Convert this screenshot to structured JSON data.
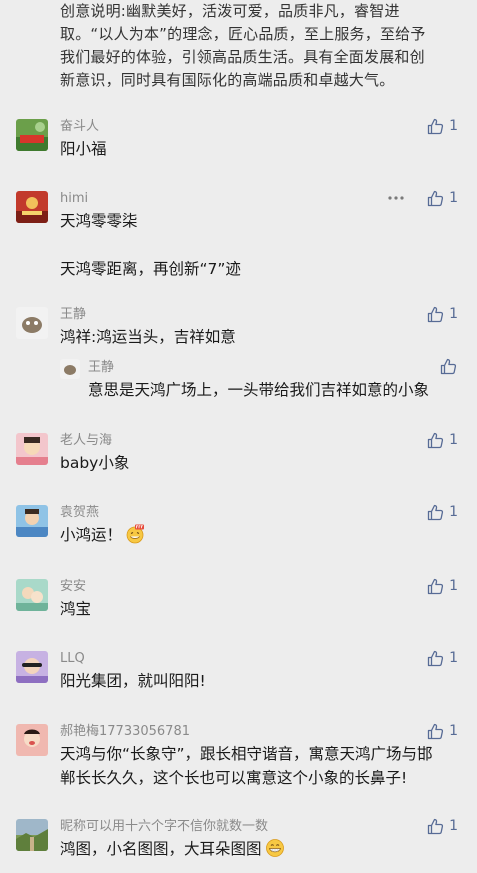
{
  "intro": {
    "lines": [
      "创意说明:幽默美好，活泼可爱，品质非凡，睿智进",
      "取。“以人为本”的理念，匠心品质，至上服务，至给予",
      "我们最好的体验，引领高品质生活。具有全面发展和创",
      "新意识，同时具有国际化的高端品质和卓越大气。"
    ]
  },
  "comments": [
    {
      "nickname": "奋斗人",
      "lines": [
        "阳小福"
      ],
      "likes": "1",
      "avatar_color": "#6aa84f"
    },
    {
      "nickname": "himi",
      "lines": [
        "天鸿零零柒",
        "",
        "天鸿零距离，再创新“7”迹"
      ],
      "likes": "1",
      "avatar_color": "#c0392b",
      "more_icon": "ellipsis-icon"
    },
    {
      "nickname": "王静",
      "lines": [
        "鸿祥:鸿运当头，吉祥如意"
      ],
      "likes": "1",
      "avatar_color": "#d9d2c5",
      "reply": {
        "nickname": "王静",
        "text": "意思是天鸿广场上，一头带给我们吉祥如意的小象"
      }
    },
    {
      "nickname": "老人与海",
      "lines": [
        "baby小象"
      ],
      "likes": "1",
      "avatar_color": "#e8a0a8"
    },
    {
      "nickname": "袁贺燕",
      "lines": [
        "小鸿运！"
      ],
      "likes": "1",
      "avatar_color": "#7ab8e0",
      "emoji": "666-grin-emoji"
    },
    {
      "nickname": "安安",
      "lines": [
        "鸿宝"
      ],
      "likes": "1",
      "avatar_color": "#9fd0c0"
    },
    {
      "nickname": "LLQ",
      "lines": [
        "阳光集团，就叫阳阳!"
      ],
      "likes": "1",
      "avatar_color": "#b79ad9"
    },
    {
      "nickname": "郝艳梅17733056781",
      "lines": [
        "天鸿与你“长象守”，跟长相守谐音，寓意天鸿广场与邯",
        "郸长长久久，这个长也可以寓意这个小象的长鼻子!"
      ],
      "likes": "1",
      "avatar_color": "#e07a7a"
    },
    {
      "nickname": "昵称可以用十六个字不信你就数一数",
      "lines": [
        "鸿图，小名图图，大耳朵图图"
      ],
      "likes": "1",
      "avatar_color": "#8fa86a",
      "emoji": "grin-emoji"
    }
  ]
}
